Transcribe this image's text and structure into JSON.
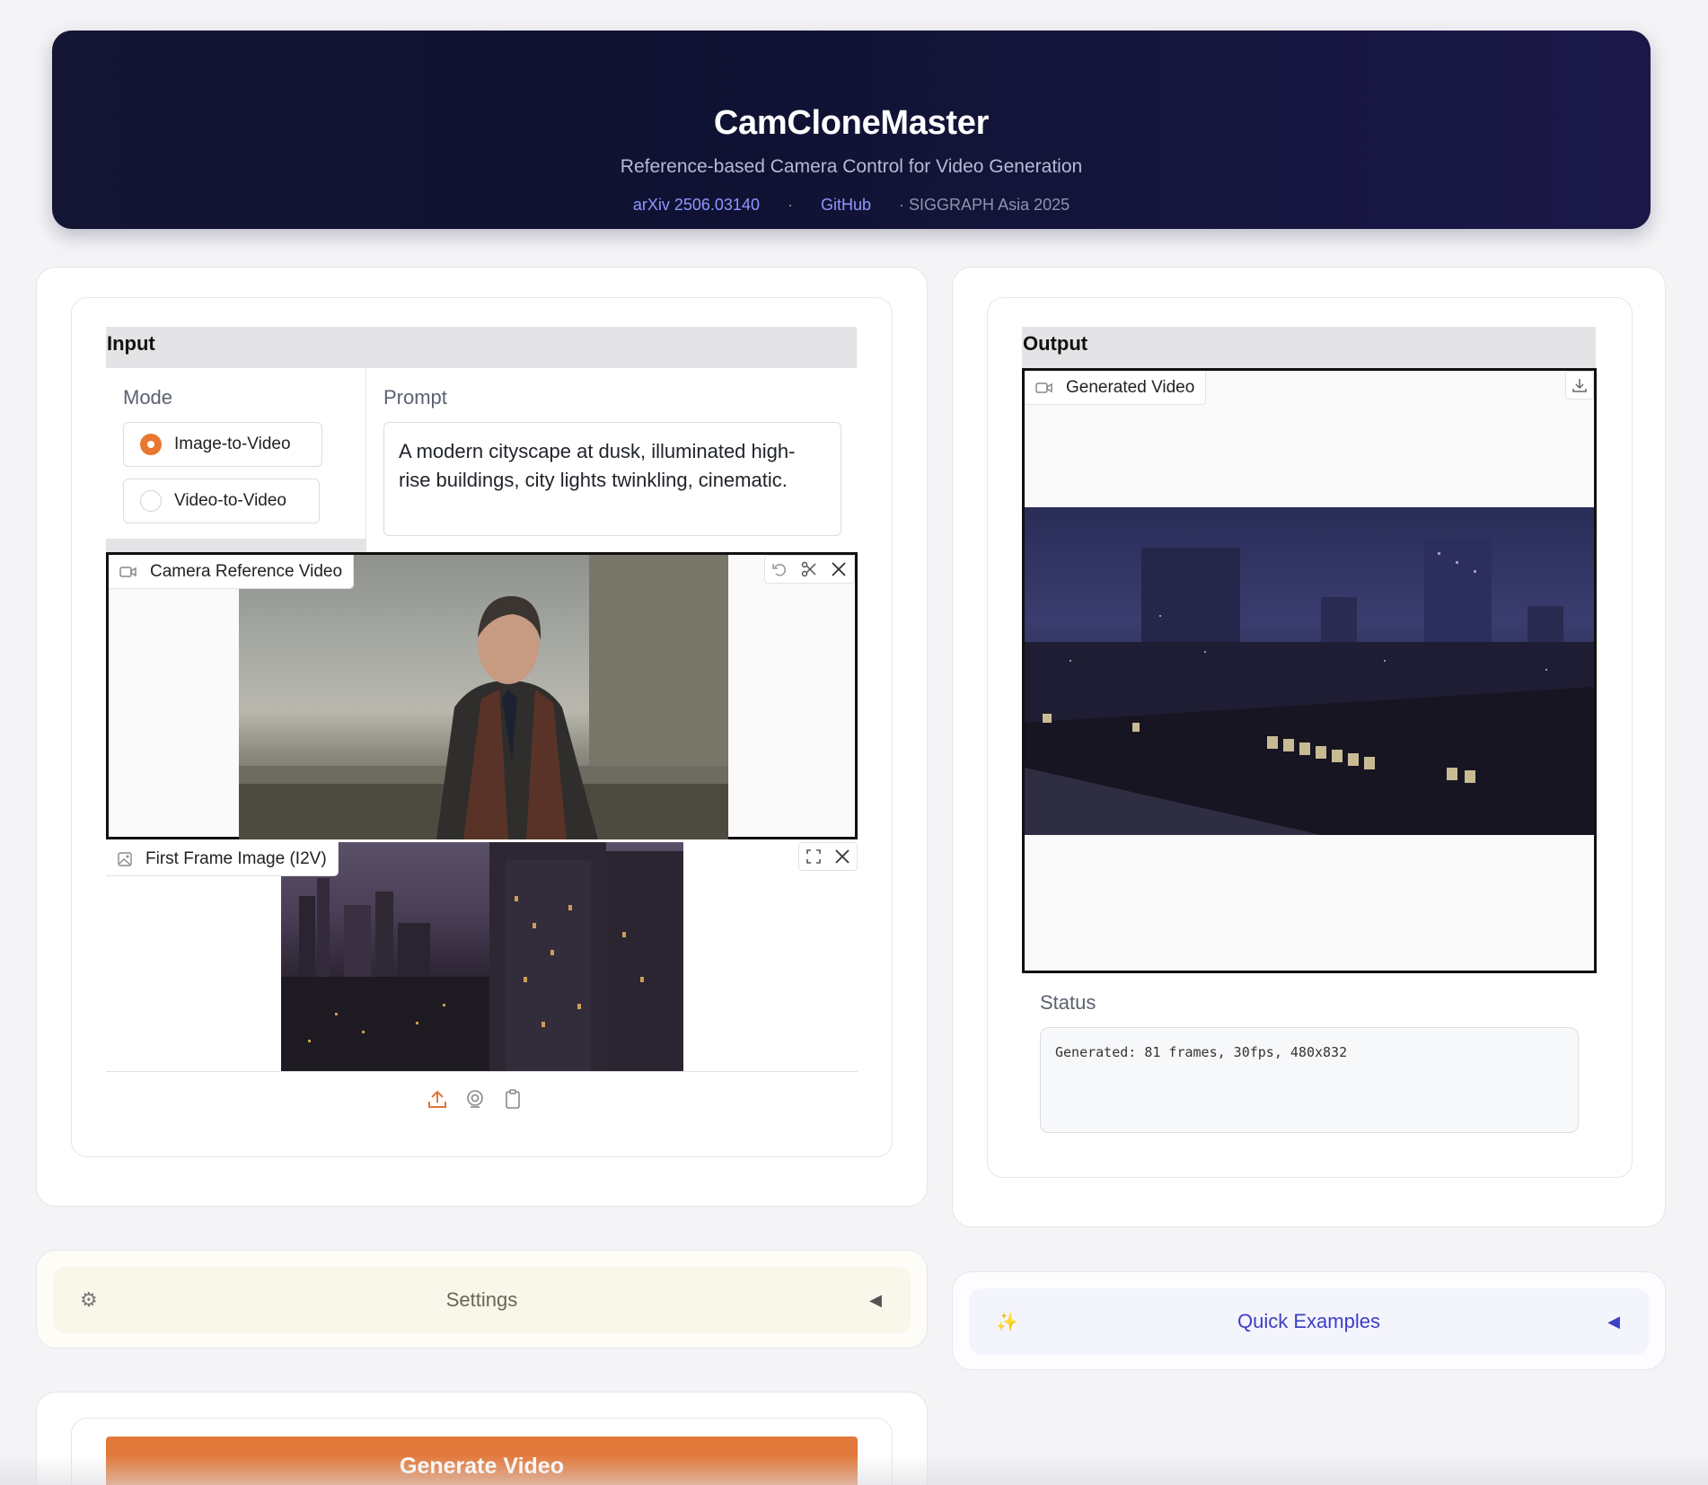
{
  "header": {
    "title": "CamCloneMaster",
    "subtitle": "Reference-based Camera Control for Video Generation",
    "link_arxiv": "arXiv 2506.03140",
    "separator": "·",
    "link_github": "GitHub",
    "venue": "· SIGGRAPH Asia 2025"
  },
  "input": {
    "section_title": "Input",
    "mode_label": "Mode",
    "mode_options": [
      "Image-to-Video",
      "Video-to-Video"
    ],
    "mode_selected": "Image-to-Video",
    "prompt_label": "Prompt",
    "prompt_value": "A modern cityscape at dusk, illuminated high-rise buildings, city lights twinkling, cinematic.",
    "camera_video_label": "Camera Reference Video",
    "first_frame_label": "First Frame Image (I2V)"
  },
  "output": {
    "section_title": "Output",
    "generated_video_label": "Generated Video",
    "status_label": "Status",
    "status_value": "Generated: 81 frames, 30fps, 480x832"
  },
  "settings": {
    "label": "Settings",
    "icon": "gear-icon",
    "arrow": "◀"
  },
  "quick_examples": {
    "label": "Quick Examples",
    "icon": "sparkles-icon",
    "arrow": "◀"
  },
  "actions": {
    "generate_label": "Generate Video"
  },
  "colors": {
    "accent": "#e2773a",
    "hero_bg": "#141534",
    "link": "#8f97ff",
    "quick_examples_text": "#3d3fc4"
  }
}
